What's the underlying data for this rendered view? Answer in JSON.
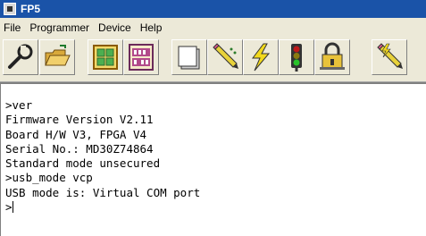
{
  "window": {
    "title": "FP5"
  },
  "menu": [
    {
      "label": "File"
    },
    {
      "label": "Programmer"
    },
    {
      "label": "Device"
    },
    {
      "label": "Help"
    }
  ],
  "toolbar": {
    "buttons": [
      {
        "icon": "wrench-icon"
      },
      {
        "icon": "open-folder-icon"
      },
      {
        "icon": "device-blocks-icon"
      },
      {
        "icon": "binary-data-icon"
      },
      {
        "icon": "blank-page-icon"
      },
      {
        "icon": "pencil-program-icon"
      },
      {
        "icon": "lightning-icon"
      },
      {
        "icon": "traffic-light-icon"
      },
      {
        "icon": "padlock-icon"
      },
      {
        "icon": "pencil-lightning-icon"
      }
    ]
  },
  "terminal": {
    "lines": [
      ">ver",
      "Firmware Version V2.11",
      "Board H/W V3, FPGA V4",
      "Serial No.: MD30Z74864",
      "Standard mode unsecured",
      ">usb_mode vcp",
      "USB mode is: Virtual COM port",
      ">"
    ]
  }
}
